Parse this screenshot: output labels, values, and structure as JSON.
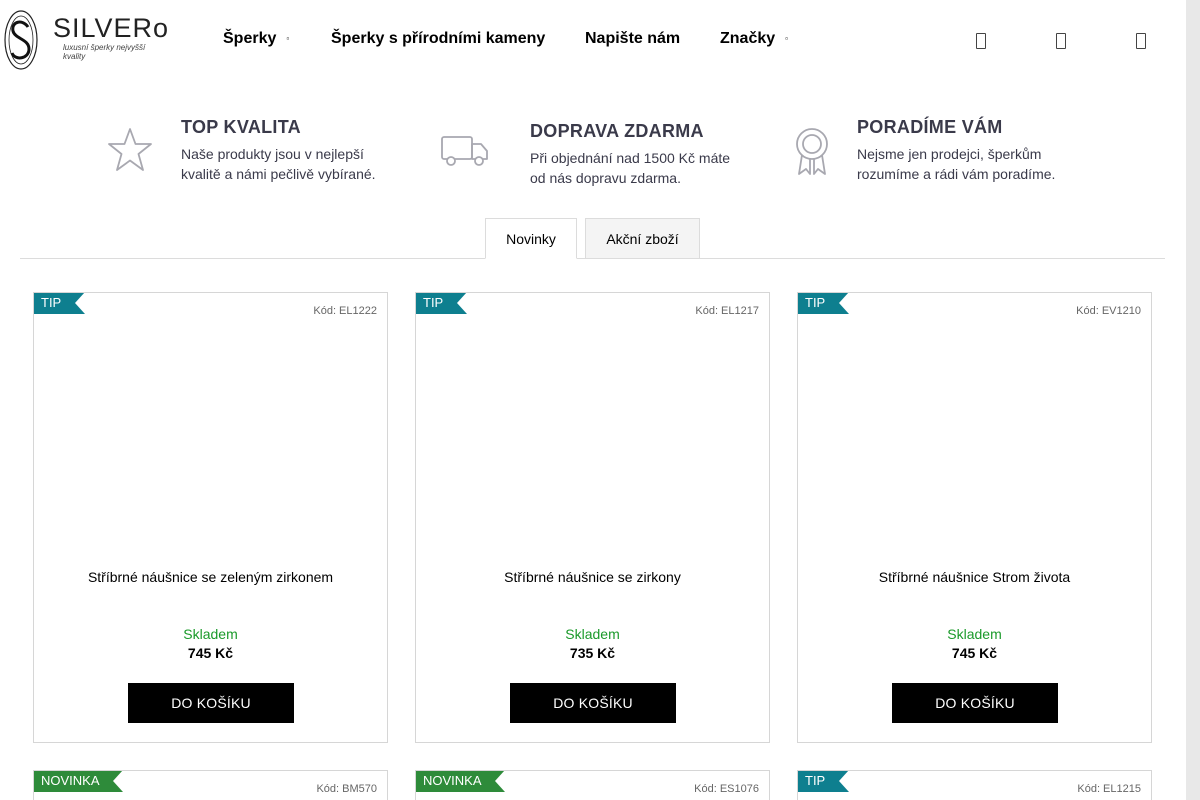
{
  "header": {
    "logo": {
      "name": "SILVERo",
      "tagline": "luxusní šperky nejvyšší kvality"
    },
    "nav": [
      {
        "label": "Šperky",
        "has_dropdown": true
      },
      {
        "label": "Šperky s přírodními kameny",
        "has_dropdown": false
      },
      {
        "label": "Napište nám",
        "has_dropdown": false
      },
      {
        "label": "Značky",
        "has_dropdown": true
      }
    ],
    "icons": [
      "search-icon",
      "user-icon",
      "cart-icon"
    ]
  },
  "benefits": [
    {
      "icon": "star-icon",
      "title": "TOP KVALITA",
      "text_line1": "Naše produkty jsou v nejlepší",
      "text_line2": "kvalitě a námi pečlivě vybírané."
    },
    {
      "icon": "truck-icon",
      "title": "DOPRAVA ZDARMA",
      "text_line1": "Při objednání nad 1500 Kč máte",
      "text_line2": "od nás dopravu zdarma."
    },
    {
      "icon": "award-icon",
      "title": "PORADÍME VÁM",
      "text_line1": "Nejsme jen prodejci, šperkům",
      "text_line2": "rozumíme a rádi vám poradíme."
    }
  ],
  "tabs": [
    {
      "label": "Novinky",
      "active": true
    },
    {
      "label": "Akční zboží",
      "active": false
    }
  ],
  "products": [
    {
      "flag": "TIP",
      "flag_type": "tip",
      "code": "Kód: EL1222",
      "name": "Stříbrné náušnice se zeleným zirkonem",
      "stock": "Skladem",
      "price": "745 Kč",
      "button": "DO KOŠÍKU"
    },
    {
      "flag": "TIP",
      "flag_type": "tip",
      "code": "Kód: EL1217",
      "name": "Stříbrné náušnice se zirkony",
      "stock": "Skladem",
      "price": "735 Kč",
      "button": "DO KOŠÍKU"
    },
    {
      "flag": "TIP",
      "flag_type": "tip",
      "code": "Kód: EV1210",
      "name": "Stříbrné náušnice Strom života",
      "stock": "Skladem",
      "price": "745 Kč",
      "button": "DO KOŠÍKU"
    },
    {
      "flag": "NOVINKA",
      "flag_type": "new",
      "code": "Kód: BM570"
    },
    {
      "flag": "NOVINKA",
      "flag_type": "new",
      "code": "Kód: ES1076"
    },
    {
      "flag": "TIP",
      "flag_type": "tip",
      "code": "Kód: EL1215"
    }
  ],
  "colors": {
    "tip_flag": "#0e7f8f",
    "new_flag": "#2e8b3a",
    "in_stock": "#1a9a2a",
    "button": "#000000"
  }
}
